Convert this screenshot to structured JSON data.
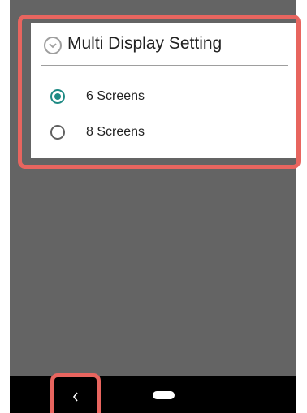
{
  "dialog": {
    "title": "Multi Display Setting",
    "header_icon": "chevron-down-circle-icon",
    "options": [
      {
        "label": "6 Screens",
        "selected": true
      },
      {
        "label": "8 Screens",
        "selected": false
      }
    ]
  },
  "nav_bar": {
    "back_icon": "back-chevron-icon",
    "home_icon": "home-pill-icon"
  },
  "colors": {
    "screen_overlay": "#646464",
    "accent": "#1e8a84",
    "highlight": "#e8655f",
    "nav_bar": "#000000"
  }
}
